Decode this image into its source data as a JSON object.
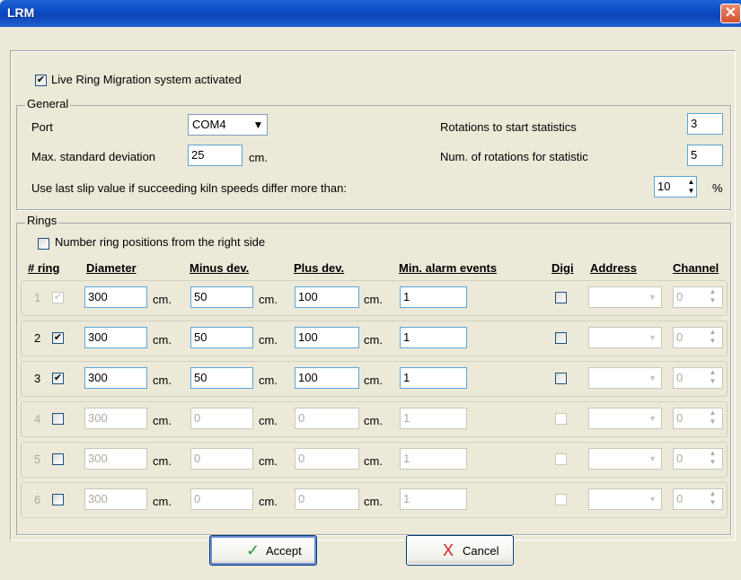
{
  "window": {
    "title": "LRM",
    "close_symbol": "✕"
  },
  "activation": {
    "label": "Live Ring Migration system activated",
    "checked": true
  },
  "general": {
    "legend": "General",
    "port_label": "Port",
    "port_value": "COM4",
    "max_std_label": "Max. standard deviation",
    "max_std_value": "25",
    "max_std_unit": "cm.",
    "rot_start_label": "Rotations to start statistics",
    "rot_start_value": "3",
    "num_rot_label": "Num. of rotations for statistic",
    "num_rot_value": "5",
    "slip_label": "Use last slip value if succeeding kiln speeds differ more than:",
    "slip_value": "10",
    "slip_unit": "%"
  },
  "rings": {
    "legend": "Rings",
    "number_from_right_label": "Number ring positions from the right side",
    "columns": {
      "ring": "# ring",
      "diameter": "Diameter",
      "minus": "Minus dev.",
      "plus": "Plus dev.",
      "min_alarm": "Min. alarm events",
      "digi": "Digi",
      "address": "Address",
      "channel": "Channel"
    },
    "unit": "cm.",
    "rows": [
      {
        "num": "1",
        "checked": true,
        "diameter": "300",
        "minus": "50",
        "plus": "100",
        "min_alarm": "1",
        "channel": "0"
      },
      {
        "num": "2",
        "checked": true,
        "diameter": "300",
        "minus": "50",
        "plus": "100",
        "min_alarm": "1",
        "channel": "0"
      },
      {
        "num": "3",
        "checked": true,
        "diameter": "300",
        "minus": "50",
        "plus": "100",
        "min_alarm": "1",
        "channel": "0"
      },
      {
        "num": "4",
        "checked": false,
        "diameter": "300",
        "minus": "0",
        "plus": "0",
        "min_alarm": "1",
        "channel": "0"
      },
      {
        "num": "5",
        "checked": false,
        "diameter": "300",
        "minus": "0",
        "plus": "0",
        "min_alarm": "1",
        "channel": "0"
      },
      {
        "num": "6",
        "checked": false,
        "diameter": "300",
        "minus": "0",
        "plus": "0",
        "min_alarm": "1",
        "channel": "0"
      }
    ]
  },
  "buttons": {
    "accept": "Accept",
    "cancel": "Cancel"
  },
  "icons": {
    "check": "✔",
    "accept_icon": "✓",
    "cancel_icon": "X",
    "dropdown": "▼",
    "spin_up": "▲",
    "spin_down": "▼"
  },
  "colors": {
    "title_blue": "#0a4bc4",
    "accept_green": "#2e9a2e",
    "cancel_red": "#d62020"
  }
}
